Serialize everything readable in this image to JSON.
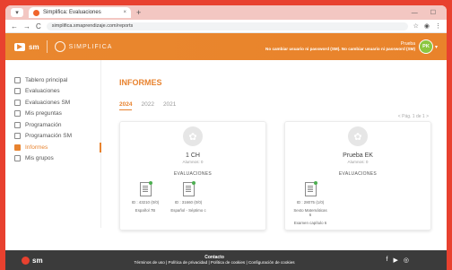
{
  "browser": {
    "tab_title": "Simplifica: Evaluaciones",
    "close": "×",
    "new_tab": "+",
    "url": "simplifica.smaprendizaje.com/reports",
    "window_controls": "— ☐",
    "nav": {
      "back": "←",
      "forward": "→",
      "reload": "C"
    }
  },
  "header": {
    "brand": "sm",
    "product": "SIMPLIFICA",
    "user_name": "Prueba",
    "user_warning": "No cambiar usuario ni password (SM). No cambiar usuario ni password (SM)",
    "avatar": "PK"
  },
  "sidebar": {
    "items": [
      {
        "label": "Tablero principal"
      },
      {
        "label": "Evaluaciones"
      },
      {
        "label": "Evaluaciones SM"
      },
      {
        "label": "Mis preguntas"
      },
      {
        "label": "Programación"
      },
      {
        "label": "Programación SM"
      },
      {
        "label": "Informes"
      },
      {
        "label": "Mis grupos"
      }
    ]
  },
  "main": {
    "title": "INFORMES",
    "years": [
      "2024",
      "2022",
      "2021"
    ],
    "pager": "< Pág. 1 de 1 >",
    "cards": [
      {
        "name": "1 CH",
        "students": "Alumnos: 0",
        "section": "EVALUACIONES",
        "docs": [
          {
            "line1": "ID : 43210 (0/0)",
            "line2": "Español 7B"
          },
          {
            "line1": "ID : 31660 (0/0)",
            "line2": "Español - Séptimo c"
          }
        ]
      },
      {
        "name": "Prueba EK",
        "students": "Alumnos: 0",
        "section": "EVALUACIONES",
        "docs": [
          {
            "line1": "ID : 28075 (1/0)",
            "line2": "Sexto Matemáticas 6",
            "line3": "Examen capítulo 6"
          }
        ]
      }
    ]
  },
  "footer": {
    "brand": "sm",
    "heading": "Contacto",
    "links": "Términos de uso | Política de privacidad | Política de cookies | Configuración de cookies"
  }
}
